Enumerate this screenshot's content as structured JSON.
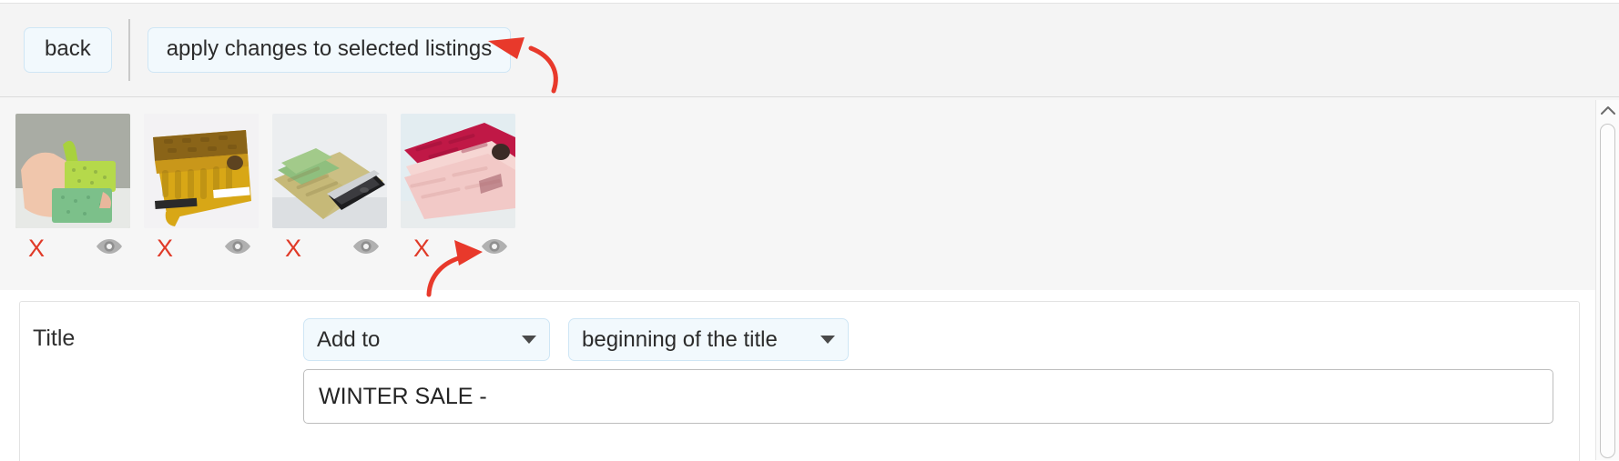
{
  "toolbar": {
    "back_label": "back",
    "apply_label": "apply changes to selected listings"
  },
  "thumbnails": [
    {
      "alt": "green crochet phone sleeve held in hand",
      "remove_label": "X",
      "preview_icon": "eye-icon"
    },
    {
      "alt": "mustard yellow crochet tablet case with button",
      "remove_label": "X",
      "preview_icon": "eye-icon"
    },
    {
      "alt": "green and tan crochet sleeve with smartphone",
      "remove_label": "X",
      "preview_icon": "eye-icon"
    },
    {
      "alt": "pink and red crochet pouch with button",
      "remove_label": "X",
      "preview_icon": "eye-icon"
    }
  ],
  "form": {
    "title_label": "Title",
    "action_select": {
      "value": "Add to",
      "caret_icon": "chevron-down-icon"
    },
    "position_select": {
      "value": "beginning of the title",
      "caret_icon": "chevron-down-icon"
    },
    "text_value": "WINTER SALE -",
    "text_placeholder": ""
  },
  "scrollbar": {
    "up_icon": "chevron-up-icon"
  },
  "annotations": [
    {
      "name": "arrow-to-apply-button",
      "color": "#e8392b"
    },
    {
      "name": "arrow-to-preview-eye",
      "color": "#e8392b"
    }
  ],
  "colors": {
    "accent_button_bg": "#f2f9fd",
    "accent_button_border": "#cfe6f5",
    "danger": "#e03a28",
    "annotation_red": "#e8392b",
    "panel_bg": "#f6f6f6"
  }
}
